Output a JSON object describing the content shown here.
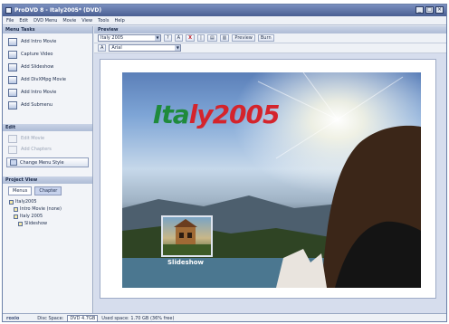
{
  "window": {
    "title": "ProDVD 8 - Italy2005* (DVD)"
  },
  "menu": [
    "File",
    "Edit",
    "DVD Menu",
    "Movie",
    "View",
    "Tools",
    "Help"
  ],
  "left": {
    "media_tools_title": "Menu Tasks",
    "media_tools": [
      "Add Intro Movie",
      "Capture Video",
      "Add Slideshow",
      "Add DivXMpg Movie",
      "Add Intro Movie",
      "Add Submenu"
    ],
    "edit_title": "Edit",
    "edit_tools": [
      "Edit Movie",
      "Add Chapters"
    ],
    "change_button": "Change Menu Style",
    "project_title": "Project View",
    "tree_tabs": [
      "Menus",
      "Chapter"
    ],
    "tree": [
      {
        "label": "Italy2005",
        "level": 1
      },
      {
        "label": "Intro Movie (none)",
        "level": 2
      },
      {
        "label": "Italy 2005",
        "level": 2
      },
      {
        "label": "Slideshow",
        "level": 3
      }
    ]
  },
  "preview": {
    "title": "Preview",
    "menu_select": "Italy 2005",
    "buttons": [
      "?",
      "A",
      "X",
      "|",
      "▤",
      "▥"
    ],
    "preview_label": "Preview",
    "burn_label": "Burn",
    "font_select": "Arial"
  },
  "photo": {
    "title_green": "Ita",
    "title_red": "ly",
    "title_year": "2005",
    "thumb_label": "Slideshow",
    "colors": {
      "green": "#1f8a3c",
      "red": "#d4242c",
      "white": "#f4f4f4"
    }
  },
  "status": {
    "logo": "roxio",
    "disc_label": "Disc Space:",
    "disc_type": "DVD 4.7GB",
    "disc_used": "Used space: 1.70 GB (36% free)"
  }
}
